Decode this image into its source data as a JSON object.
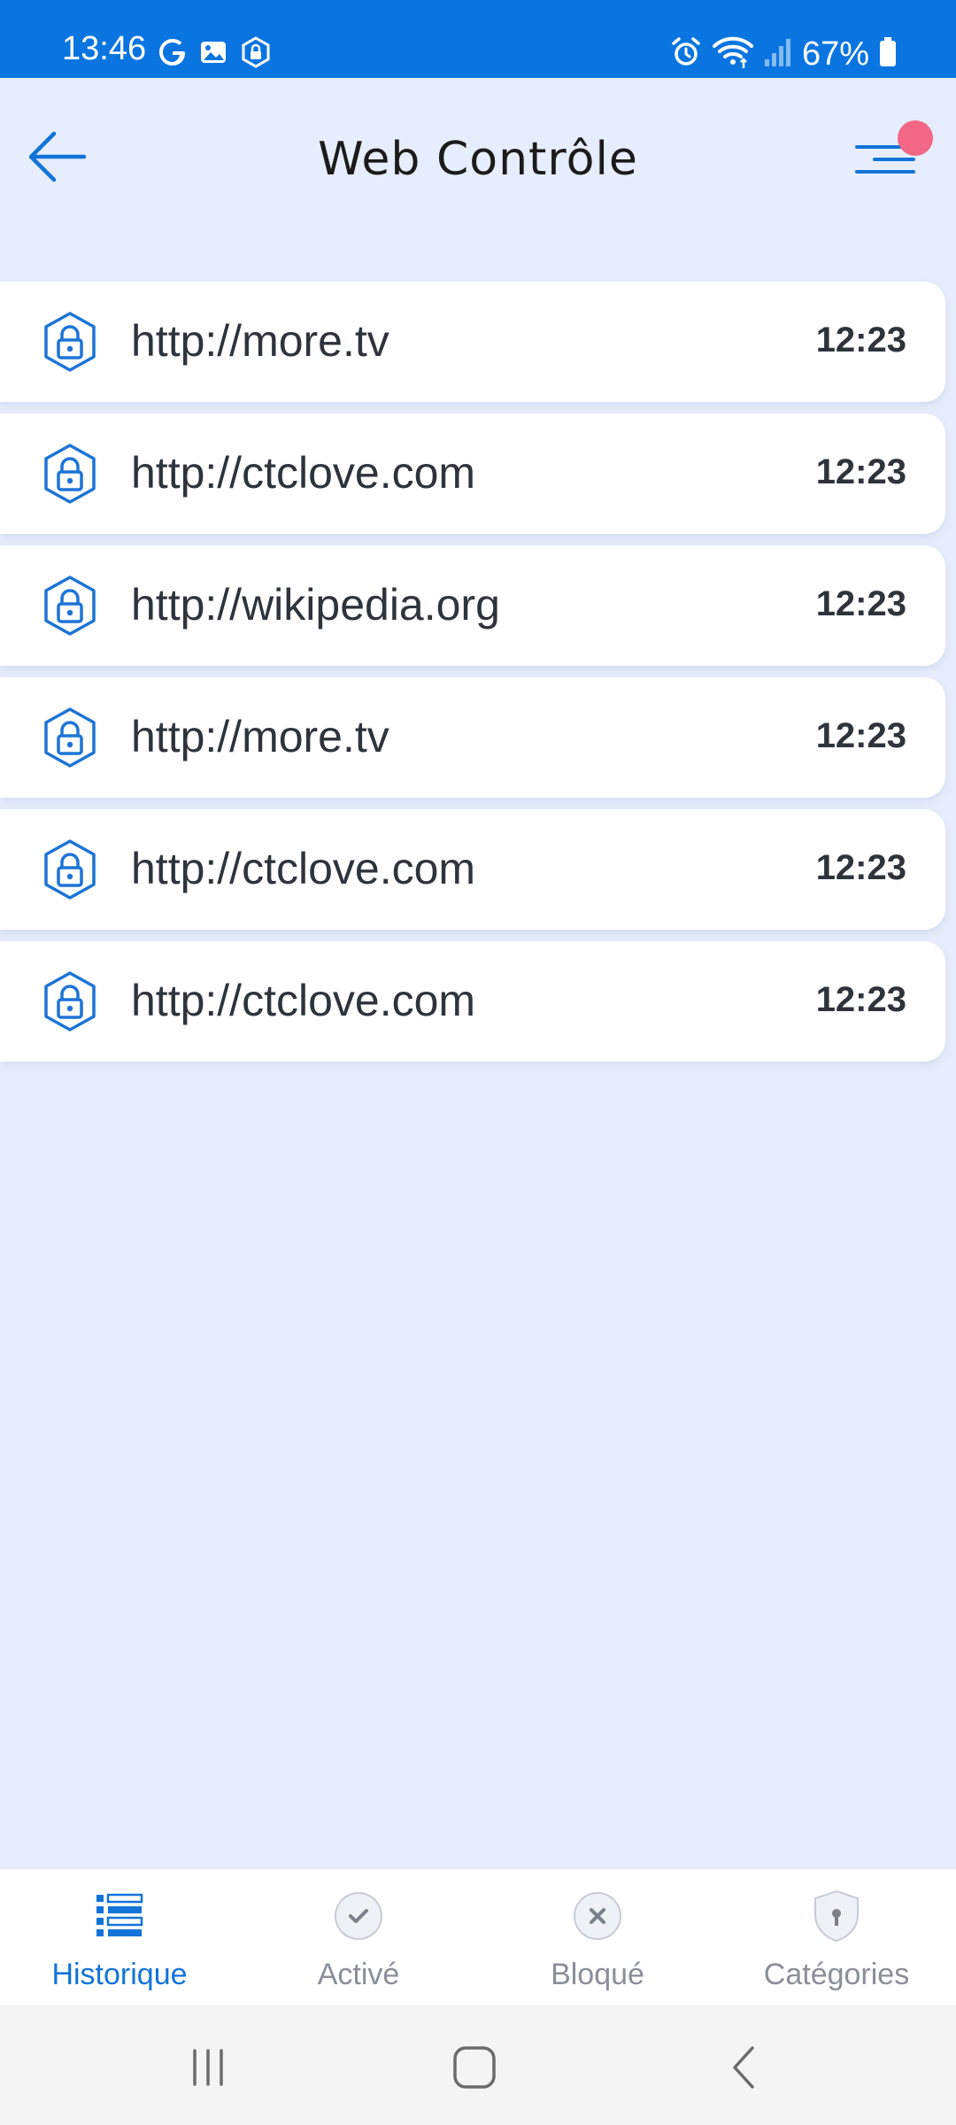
{
  "status_bar": {
    "time": "13:46",
    "battery": "67%",
    "icons": [
      "google-icon",
      "gallery-icon",
      "vpn-icon",
      "alarm-icon",
      "wifi-icon",
      "signal-icon",
      "battery-icon"
    ]
  },
  "header": {
    "title": "Web Contrôle",
    "back_icon": "arrow-left-icon",
    "menu_icon": "menu-icon"
  },
  "list": {
    "items": [
      {
        "url": "http://more.tv",
        "time": "12:23",
        "icon": "lock-icon"
      },
      {
        "url": "http://ctclove.com",
        "time": "12:23",
        "icon": "lock-icon"
      },
      {
        "url": "http://wikipedia.org",
        "time": "12:23",
        "icon": "lock-icon"
      },
      {
        "url": "http://more.tv",
        "time": "12:23",
        "icon": "lock-icon"
      },
      {
        "url": "http://ctclove.com",
        "time": "12:23",
        "icon": "lock-icon"
      },
      {
        "url": "http://ctclove.com",
        "time": "12:23",
        "icon": "lock-icon"
      }
    ]
  },
  "bottom_nav": {
    "tabs": [
      {
        "label": "Historique",
        "icon": "list-icon",
        "active": true
      },
      {
        "label": "Activé",
        "icon": "check-icon",
        "active": false
      },
      {
        "label": "Bloqué",
        "icon": "close-icon",
        "active": false
      },
      {
        "label": "Catégories",
        "icon": "shield-icon",
        "active": false
      }
    ]
  },
  "colors": {
    "status_bar": "#0a75e0",
    "background": "#e6edfc",
    "accent": "#1274d9",
    "notification_dot": "#f26686"
  }
}
